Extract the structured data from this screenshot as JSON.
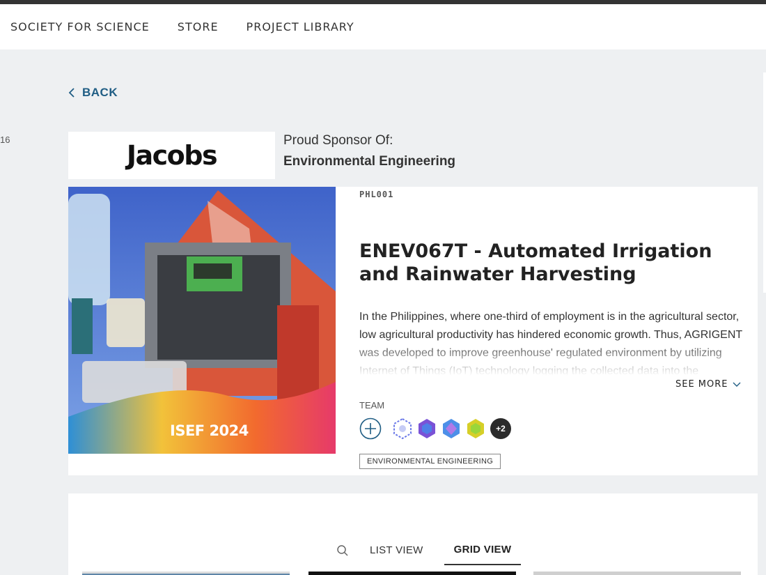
{
  "nav": {
    "items": [
      {
        "label": "SOCIETY FOR SCIENCE"
      },
      {
        "label": "STORE"
      },
      {
        "label": "PROJECT LIBRARY"
      }
    ]
  },
  "side_number": "16",
  "back_label": "BACK",
  "sponsor": {
    "logo_text": "Jacobs",
    "label": "Proud Sponsor Of:",
    "name": "Environmental Engineering"
  },
  "project": {
    "image_caption": "ISEF 2024",
    "code": "PHL001",
    "title": "ENEV067T - Automated Irrigation and Rainwater Harvesting",
    "abstract": "In the Philippines, where one-third of employment is in the agricultural sector, low agricultural productivity has hindered economic growth. Thus, AGRIGENT was developed to improve greenhouse' regulated environment by utilizing Internet of Things (IoT) technology logging the collected data into the ThingSpeak server and features",
    "see_more": "SEE MORE",
    "team_label": "TEAM",
    "team_extra": "+2",
    "category_tag": "ENVIRONMENTAL ENGINEERING"
  },
  "views": {
    "list_label": "LIST VIEW",
    "grid_label": "GRID VIEW",
    "active": "GRID VIEW"
  },
  "colors": {
    "link_blue": "#1f5d84",
    "background": "#eef0f2"
  }
}
